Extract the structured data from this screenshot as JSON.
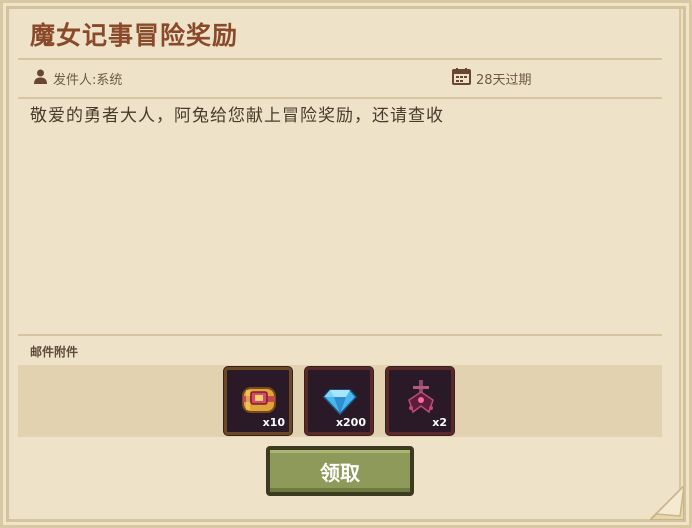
{
  "mail": {
    "title": "魔女记事冒险奖励",
    "sender": "发件人:系统",
    "expires": "28天过期",
    "body": "敬爱的勇者大人，阿兔给您献上冒险奖励，还请查收"
  },
  "attachments": {
    "label": "邮件附件",
    "items": [
      {
        "icon": "treasure-chest-icon",
        "count": "x10"
      },
      {
        "icon": "diamond-icon",
        "count": "x200"
      },
      {
        "icon": "dark-artifact-icon",
        "count": "x2"
      }
    ]
  },
  "actions": {
    "claim_label": "领取"
  },
  "colors": {
    "title": "#8a4a2a",
    "paper": "#eee3c9",
    "button": "#8e9a5a"
  }
}
